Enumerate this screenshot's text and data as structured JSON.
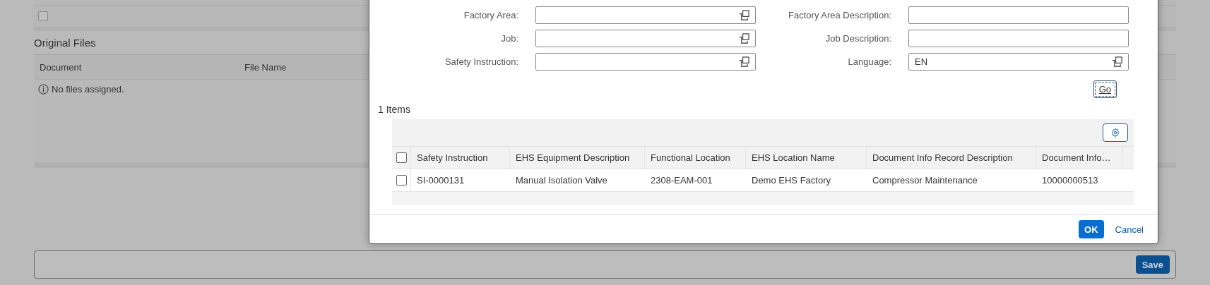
{
  "background_table": {
    "rows": [
      {
        "checked": false
      }
    ]
  },
  "original_files": {
    "title": "Original Files",
    "columns": [
      "Document",
      "File Name"
    ],
    "empty_message": "No files assigned."
  },
  "footer": {
    "save_button": "Save"
  },
  "dialog": {
    "fields_left": [
      {
        "label": "Factory Area:",
        "value_help": true
      },
      {
        "label": "Job:",
        "value_help": true
      },
      {
        "label": "Safety Instruction:",
        "value_help": true
      }
    ],
    "fields_right": [
      {
        "label": "Factory Area Description:",
        "value_help": false
      },
      {
        "label": "Job Description:",
        "value_help": false
      },
      {
        "label": "Language:",
        "value": "EN",
        "value_help": true
      }
    ],
    "go_button": "Go",
    "items_count": "1 Items",
    "table": {
      "columns": [
        "Safety Instruction",
        "EHS Equipment Description",
        "Functional Location",
        "EHS Location Name",
        "Document Info Record Description",
        "Document Info…"
      ],
      "rows": [
        {
          "selected": false,
          "cells": [
            "SI-0000131",
            "Manual Isolation Valve",
            "2308-EAM-001",
            "Demo EHS Factory",
            "Compressor Maintenance",
            "10000000513"
          ]
        }
      ],
      "all_selected": false
    },
    "ok_button": "OK",
    "cancel_button": "Cancel"
  }
}
